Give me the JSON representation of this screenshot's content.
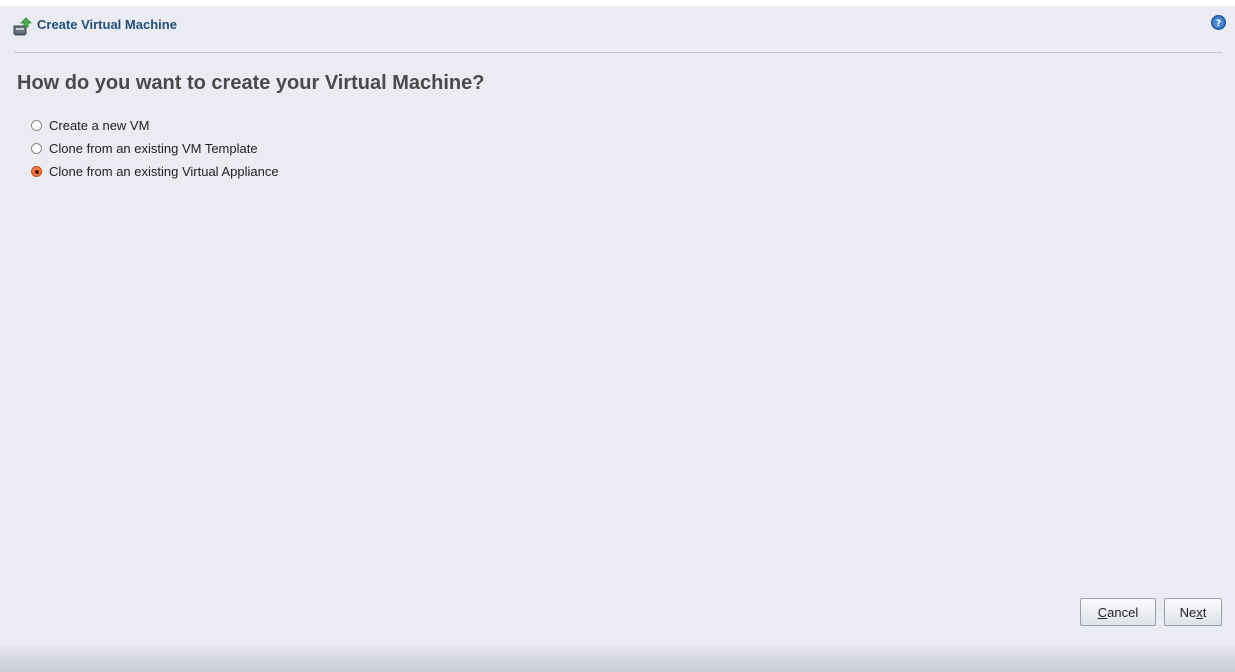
{
  "window": {
    "title": "Create Virtual Machine",
    "icons": {
      "title_icon": "create-vm-icon",
      "help_icon": "help-icon"
    }
  },
  "main": {
    "heading": "How do you want to create your Virtual Machine?",
    "options": [
      {
        "label": "Create a new VM",
        "selected": false
      },
      {
        "label": "Clone from an existing VM Template",
        "selected": false
      },
      {
        "label": "Clone from an existing Virtual Appliance",
        "selected": true
      }
    ]
  },
  "buttons": {
    "cancel": {
      "mnemonic": "C",
      "rest": "ancel"
    },
    "next": {
      "prefix": "Ne",
      "mnemonic": "x",
      "rest": "t"
    }
  },
  "colors": {
    "title": "#1f4f7a",
    "radio_selected": "#f27646",
    "background": "#ebebf3"
  }
}
